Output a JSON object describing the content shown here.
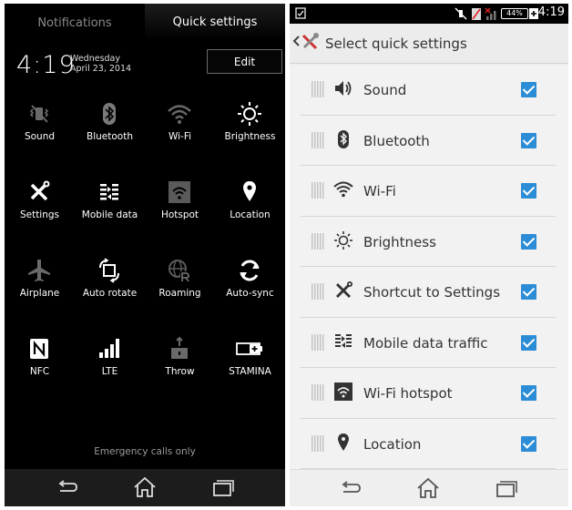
{
  "left": {
    "tabs": {
      "notifications": "Notifications",
      "quick_settings": "Quick settings"
    },
    "clock": {
      "time": "4:19",
      "day": "Wednesday",
      "date": "April 23, 2014"
    },
    "edit_label": "Edit",
    "tiles": [
      {
        "label": "Sound",
        "icon": "vibrate-off-icon"
      },
      {
        "label": "Bluetooth",
        "icon": "bluetooth-icon"
      },
      {
        "label": "Wi-Fi",
        "icon": "wifi-icon"
      },
      {
        "label": "Brightness",
        "icon": "brightness-icon"
      },
      {
        "label": "Settings",
        "icon": "settings-tools-icon"
      },
      {
        "label": "Mobile data",
        "icon": "mobile-data-icon"
      },
      {
        "label": "Hotspot",
        "icon": "hotspot-icon"
      },
      {
        "label": "Location",
        "icon": "location-icon"
      },
      {
        "label": "Airplane",
        "icon": "airplane-icon"
      },
      {
        "label": "Auto rotate",
        "icon": "auto-rotate-icon"
      },
      {
        "label": "Roaming",
        "icon": "roaming-icon"
      },
      {
        "label": "Auto-sync",
        "icon": "sync-icon"
      },
      {
        "label": "NFC",
        "icon": "nfc-icon"
      },
      {
        "label": "LTE",
        "icon": "signal-icon"
      },
      {
        "label": "Throw",
        "icon": "throw-icon"
      },
      {
        "label": "STAMINA",
        "icon": "stamina-battery-icon"
      }
    ],
    "emergency": "Emergency calls only"
  },
  "right": {
    "status": {
      "battery": "44%",
      "time": "4:19"
    },
    "title": "Select quick settings",
    "items": [
      {
        "label": "Sound",
        "icon": "sound-icon",
        "checked": true
      },
      {
        "label": "Bluetooth",
        "icon": "bluetooth-icon",
        "checked": true
      },
      {
        "label": "Wi-Fi",
        "icon": "wifi-icon",
        "checked": true
      },
      {
        "label": "Brightness",
        "icon": "brightness-icon",
        "checked": true
      },
      {
        "label": "Shortcut to Settings",
        "icon": "settings-tools-icon",
        "checked": true
      },
      {
        "label": "Mobile data traffic",
        "icon": "mobile-data-icon",
        "checked": true
      },
      {
        "label": "Wi-Fi hotspot",
        "icon": "hotspot-icon",
        "checked": true
      },
      {
        "label": "Location",
        "icon": "location-icon",
        "checked": true
      }
    ]
  },
  "colors": {
    "checkbox": "#2c8dd6",
    "left_bg": "#000000",
    "right_bg": "#ececec"
  }
}
